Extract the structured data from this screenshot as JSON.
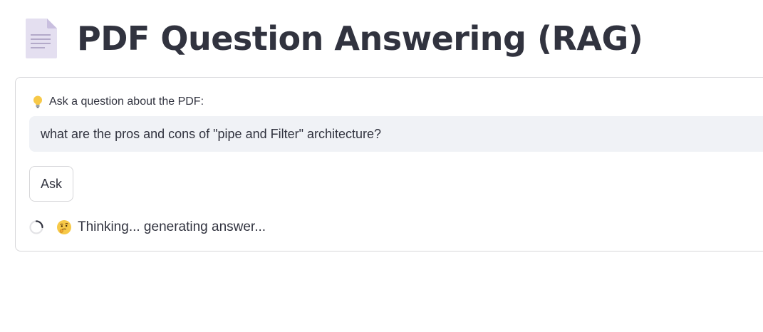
{
  "header": {
    "title": "PDF Question Answering (RAG)",
    "icon": "document-icon"
  },
  "form": {
    "label_icon": "lightbulb-icon",
    "label": "Ask a question about the PDF:",
    "input_value": "what are the pros and cons of \"pipe and Filter\" architecture?",
    "ask_label": "Ask"
  },
  "status": {
    "spinner_icon": "spinner-icon",
    "emoji_icon": "thinking-face-icon",
    "text": "Thinking... generating answer..."
  },
  "colors": {
    "text": "#31333f",
    "input_bg": "#f0f2f6",
    "border": "#d6d6d9",
    "icon_doc": "#e4dff0"
  }
}
